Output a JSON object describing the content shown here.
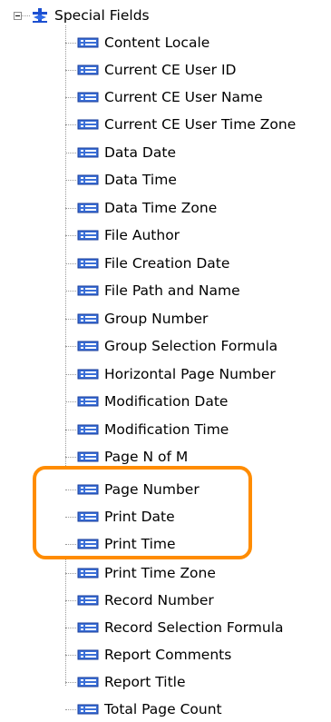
{
  "tree": {
    "root": {
      "label": "Special Fields",
      "icon": "special-fields-icon",
      "expanded": true
    },
    "items": [
      {
        "label": "Content Locale"
      },
      {
        "label": "Current CE User ID"
      },
      {
        "label": "Current CE User Name"
      },
      {
        "label": "Current CE User Time Zone"
      },
      {
        "label": "Data Date"
      },
      {
        "label": "Data Time"
      },
      {
        "label": "Data Time Zone"
      },
      {
        "label": "File Author"
      },
      {
        "label": "File Creation Date"
      },
      {
        "label": "File Path and Name"
      },
      {
        "label": "Group Number"
      },
      {
        "label": "Group Selection Formula"
      },
      {
        "label": "Horizontal Page Number"
      },
      {
        "label": "Modification Date"
      },
      {
        "label": "Modification Time"
      },
      {
        "label": "Page N of M"
      },
      {
        "label": "Page Number"
      },
      {
        "label": "Print Date"
      },
      {
        "label": "Print Time"
      },
      {
        "label": "Print Time Zone"
      },
      {
        "label": "Record Number"
      },
      {
        "label": "Record Selection Formula"
      },
      {
        "label": "Report Comments"
      },
      {
        "label": "Report Title"
      },
      {
        "label": "Total Page Count"
      }
    ],
    "field_icon": "field-icon"
  },
  "highlight": {
    "color": "#ff8c00",
    "covers": [
      "Page Number",
      "Print Date",
      "Print Time"
    ]
  }
}
